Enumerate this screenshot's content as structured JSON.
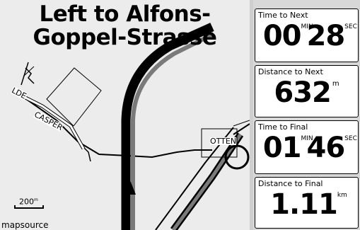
{
  "instruction": {
    "line1": "Left to Alfons-",
    "line2": "Goppel-Strasse"
  },
  "map": {
    "street_labels": {
      "casper": "CASPER",
      "otten": "OTTEN",
      "lde": "LDE"
    },
    "scale": {
      "value": "200",
      "unit": "m"
    },
    "attribution": "mapsource",
    "icons": [
      "position-arrow-icon",
      "waypoint-flag-icon"
    ]
  },
  "fields": [
    {
      "label": "Time to Next",
      "parts": [
        {
          "text": "00",
          "unit": "MIN"
        },
        {
          "text": "28",
          "unit": "SEC"
        }
      ]
    },
    {
      "label": "Distance to Next",
      "parts": [
        {
          "text": "632",
          "unit": "m"
        }
      ]
    },
    {
      "label": "Time to Final",
      "parts": [
        {
          "text": "01",
          "unit": "MIN"
        },
        {
          "text": "46",
          "unit": "SEC"
        }
      ]
    },
    {
      "label": "Distance to Final",
      "parts": [
        {
          "text": "1.11",
          "unit": "km"
        }
      ]
    }
  ],
  "colors": {
    "map_background": "#ececec",
    "route_highlight": "#7a7a7a",
    "road": "#000000",
    "field_background": "#ffffff"
  }
}
